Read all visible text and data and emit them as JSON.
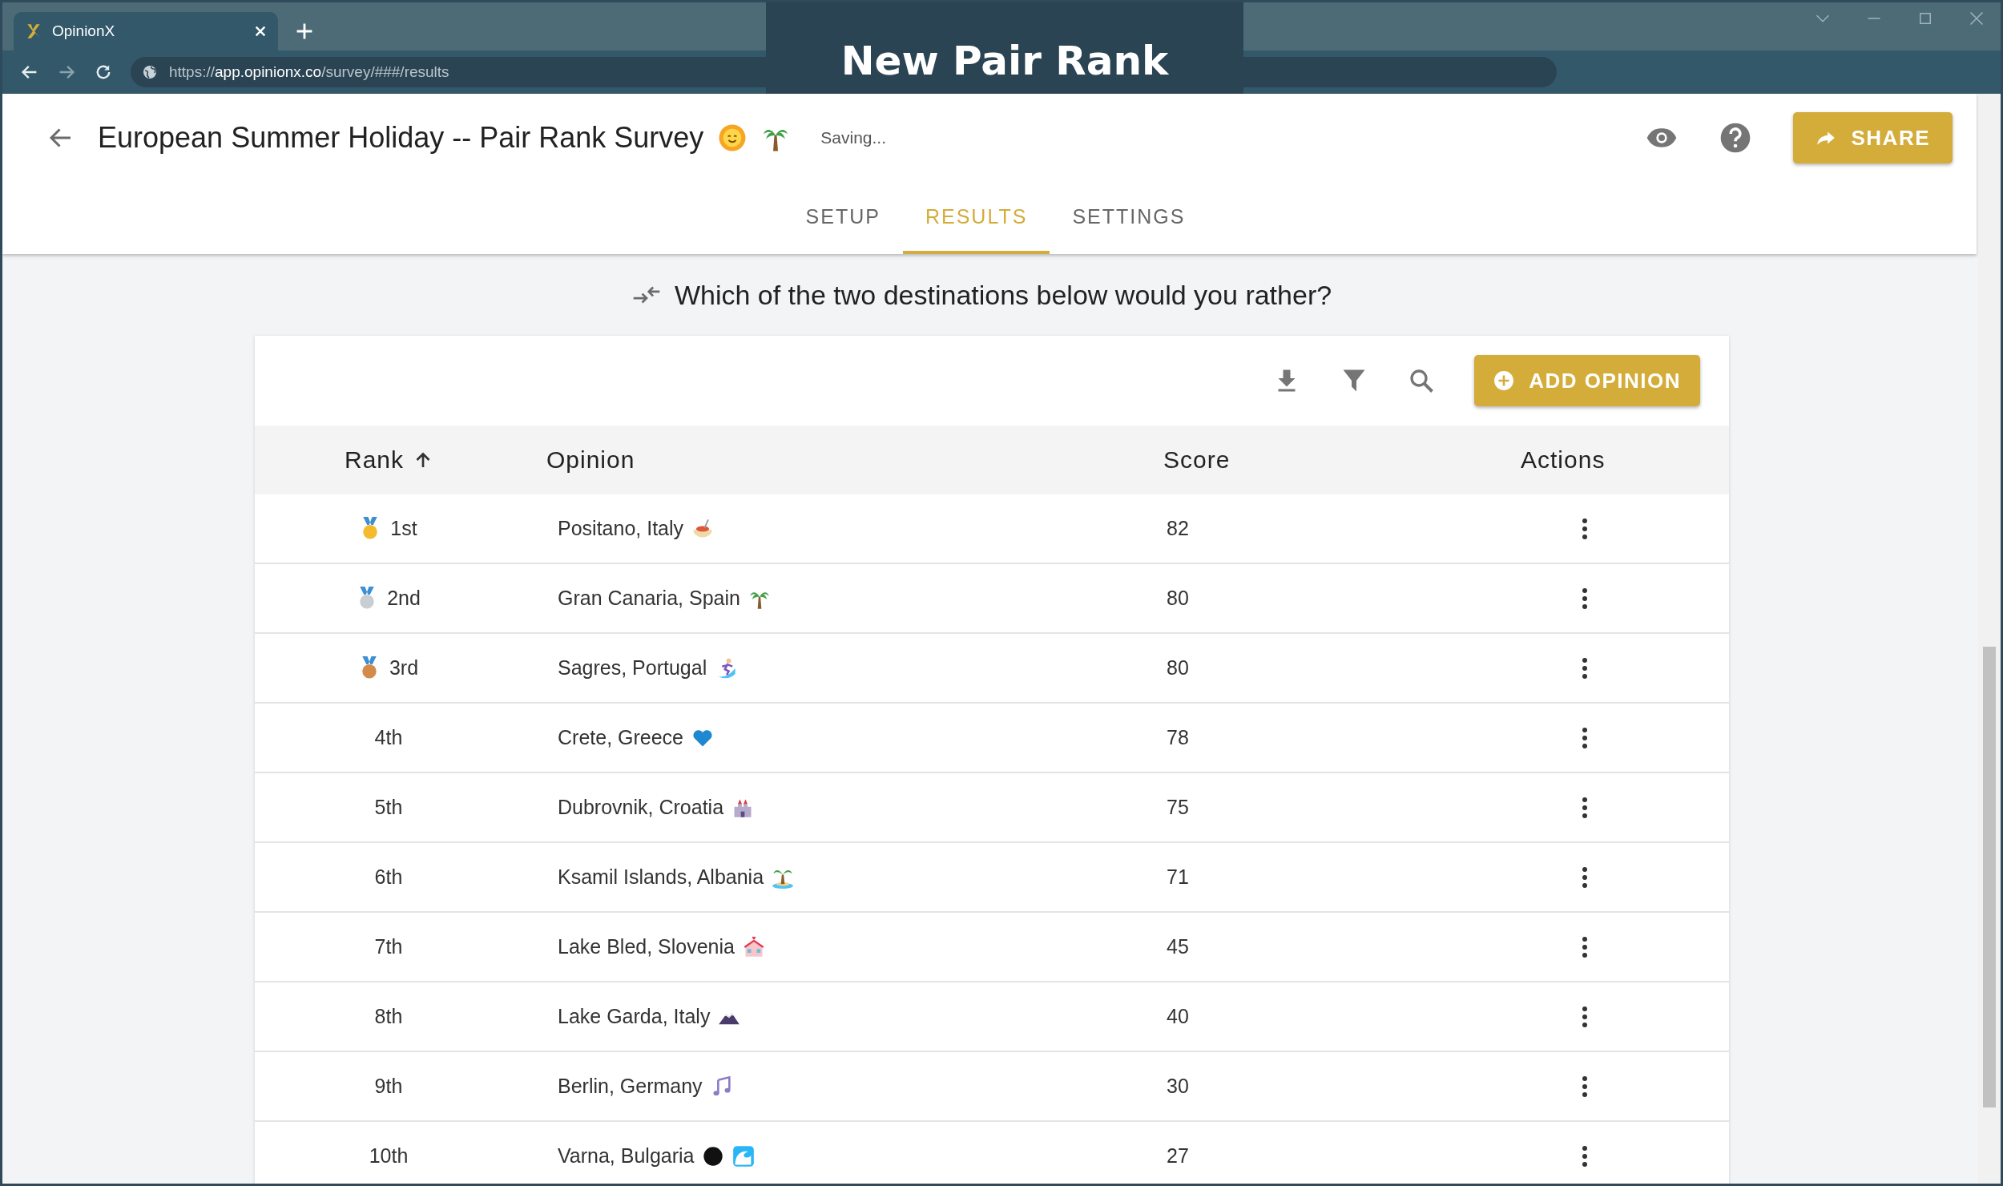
{
  "browser": {
    "tab_title": "OpinionX",
    "url_scheme": "https://",
    "url_host": "app.opinionx.co",
    "url_path": "/survey/###/results"
  },
  "banner": {
    "title": "New Pair Rank"
  },
  "header": {
    "title": "European Summer Holiday -- Pair Rank Survey",
    "status": "Saving...",
    "share_label": "SHARE"
  },
  "tabs": [
    {
      "label": "SETUP",
      "selected": false
    },
    {
      "label": "RESULTS",
      "selected": true
    },
    {
      "label": "SETTINGS",
      "selected": false
    }
  ],
  "question": "Which of the two destinations below would you rather?",
  "toolbar": {
    "add_label": "ADD OPINION"
  },
  "table": {
    "columns": [
      "Rank",
      "Opinion",
      "Score",
      "Actions"
    ],
    "rows": [
      {
        "rank": "1st",
        "color": "#f4bb2f",
        "opinion": "Positano, Italy",
        "kind": "pasta",
        "score": "82"
      },
      {
        "rank": "2nd",
        "color": "#c9ced3",
        "opinion": "Gran Canaria, Spain",
        "kind": "palm",
        "score": "80"
      },
      {
        "rank": "3rd",
        "color": "#d38b4a",
        "opinion": "Sagres, Portugal",
        "kind": "surfer",
        "score": "80"
      },
      {
        "rank": "4th",
        "opinion": "Crete, Greece",
        "kind": "heart",
        "score": "78"
      },
      {
        "rank": "5th",
        "opinion": "Dubrovnik, Croatia",
        "kind": "castle",
        "score": "75"
      },
      {
        "rank": "6th",
        "opinion": "Ksamil Islands, Albania",
        "kind": "island",
        "score": "71"
      },
      {
        "rank": "7th",
        "opinion": "Lake Bled, Slovenia",
        "kind": "chapel",
        "score": "45"
      },
      {
        "rank": "8th",
        "opinion": "Lake Garda, Italy",
        "kind": "mountain",
        "score": "40"
      },
      {
        "rank": "9th",
        "opinion": "Berlin, Germany",
        "kind": "music",
        "score": "30"
      },
      {
        "rank": "10th",
        "opinion": "Varna, Bulgaria",
        "kind": "circle-wave",
        "score": "27"
      }
    ]
  }
}
